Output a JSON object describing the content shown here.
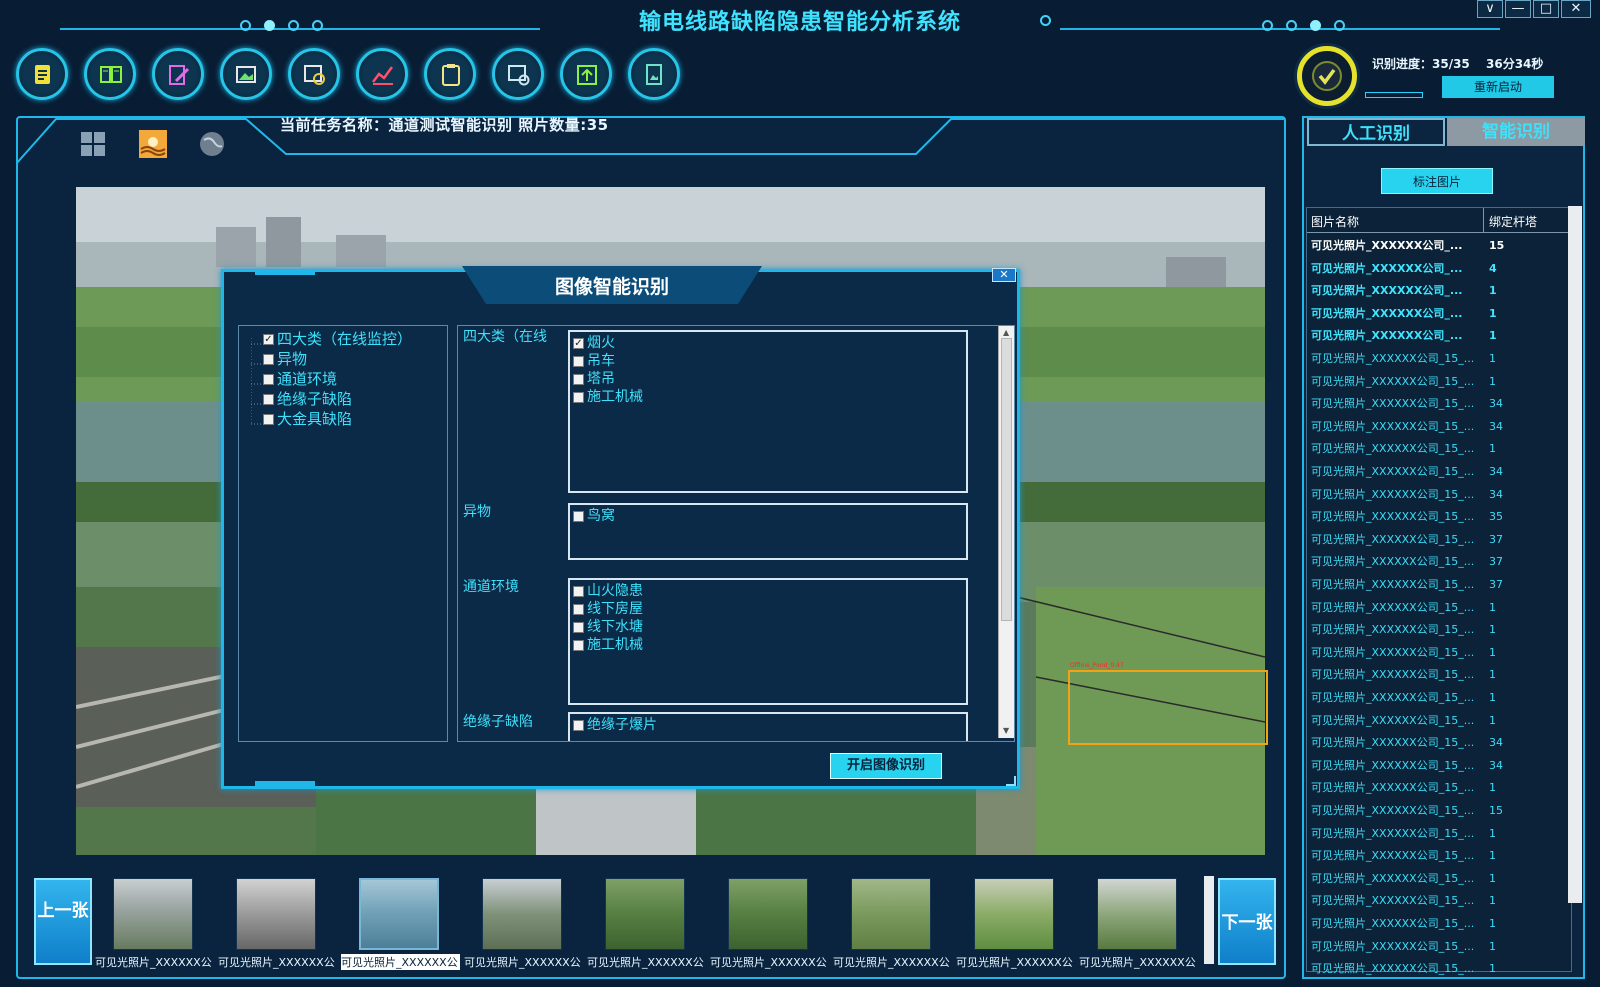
{
  "window": {
    "title": "输电线路缺陷隐患智能分析系统",
    "controls": [
      "∨",
      "—",
      "□",
      "✕"
    ]
  },
  "toolbar": {
    "icons": [
      "document-icon",
      "book-icon",
      "edit-icon",
      "image-gallery-icon",
      "image-search-icon",
      "chart-icon",
      "clipboard-icon",
      "pdf-preview-icon",
      "export-icon",
      "image-upload-icon"
    ]
  },
  "progress": {
    "label": "识别进度：35/35",
    "time": "36分34秒",
    "restart": "重新启动",
    "ratio": 1.0
  },
  "main": {
    "task": "当前任务名称：通道测试智能识别  照片数量:35",
    "view_icons": [
      "grid-icon",
      "landscape-icon",
      "globe-icon"
    ]
  },
  "photo": {
    "detection_label": "Offline_Pond_0.47"
  },
  "dialog": {
    "title": "图像智能识别",
    "close": "✕",
    "tree": [
      {
        "label": "四大类（在线监控）",
        "checked": true
      },
      {
        "label": "异物",
        "checked": false
      },
      {
        "label": "通道环境",
        "checked": false
      },
      {
        "label": "绝缘子缺陷",
        "checked": false
      },
      {
        "label": "大金具缺陷",
        "checked": false
      }
    ],
    "categories": [
      {
        "label": "四大类（在线",
        "options": [
          {
            "label": "烟火",
            "checked": true
          },
          {
            "label": "吊车",
            "checked": false
          },
          {
            "label": "塔吊",
            "checked": false
          },
          {
            "label": "施工机械",
            "checked": false
          }
        ]
      },
      {
        "label": "异物",
        "options": [
          {
            "label": "鸟窝",
            "checked": false
          }
        ]
      },
      {
        "label": "通道环境",
        "options": [
          {
            "label": "山火隐患",
            "checked": false
          },
          {
            "label": "线下房屋",
            "checked": false
          },
          {
            "label": "线下水塘",
            "checked": false
          },
          {
            "label": "施工机械",
            "checked": false
          }
        ]
      },
      {
        "label": "绝缘子缺陷",
        "options": [
          {
            "label": "绝缘子爆片",
            "checked": false
          }
        ]
      }
    ],
    "start": "开启图像识别"
  },
  "thumbnails": {
    "prev": "上一张",
    "next": "下一张",
    "captions": [
      "可见光照片_XXXXXX公",
      "可见光照片_XXXXXX公",
      "可见光照片_XXXXXX公",
      "可见光照片_XXXXXX公",
      "可见光照片_XXXXXX公",
      "可见光照片_XXXXXX公",
      "可见光照片_XXXXXX公",
      "可见光照片_XXXXXX公",
      "可见光照片_XXXXXX公"
    ],
    "selected_index": 2
  },
  "side": {
    "tabs": [
      "人工识别",
      "智能识别"
    ],
    "annotate": "标注图片",
    "columns": [
      "图片名称",
      "绑定杆塔"
    ],
    "rows": [
      {
        "name": "可见光照片_XXXXXX公司_...",
        "tower": "15",
        "style": "b1"
      },
      {
        "name": "可见光照片_XXXXXX公司_...",
        "tower": "4",
        "style": "b2"
      },
      {
        "name": "可见光照片_XXXXXX公司_...",
        "tower": "1",
        "style": "b2"
      },
      {
        "name": "可见光照片_XXXXXX公司_...",
        "tower": "1",
        "style": "b2"
      },
      {
        "name": "可见光照片_XXXXXX公司_...",
        "tower": "1",
        "style": "b2"
      },
      {
        "name": "可见光照片_XXXXXX公司_15_...",
        "tower": "1",
        "style": "n"
      },
      {
        "name": "可见光照片_XXXXXX公司_15_...",
        "tower": "1",
        "style": "n"
      },
      {
        "name": "可见光照片_XXXXXX公司_15_...",
        "tower": "34",
        "style": "n"
      },
      {
        "name": "可见光照片_XXXXXX公司_15_...",
        "tower": "34",
        "style": "n"
      },
      {
        "name": "可见光照片_XXXXXX公司_15_...",
        "tower": "1",
        "style": "n"
      },
      {
        "name": "可见光照片_XXXXXX公司_15_...",
        "tower": "34",
        "style": "n"
      },
      {
        "name": "可见光照片_XXXXXX公司_15_...",
        "tower": "34",
        "style": "n"
      },
      {
        "name": "可见光照片_XXXXXX公司_15_...",
        "tower": "35",
        "style": "n"
      },
      {
        "name": "可见光照片_XXXXXX公司_15_...",
        "tower": "37",
        "style": "n"
      },
      {
        "name": "可见光照片_XXXXXX公司_15_...",
        "tower": "37",
        "style": "n"
      },
      {
        "name": "可见光照片_XXXXXX公司_15_...",
        "tower": "37",
        "style": "n"
      },
      {
        "name": "可见光照片_XXXXXX公司_15_...",
        "tower": "1",
        "style": "n"
      },
      {
        "name": "可见光照片_XXXXXX公司_15_...",
        "tower": "1",
        "style": "n"
      },
      {
        "name": "可见光照片_XXXXXX公司_15_...",
        "tower": "1",
        "style": "n"
      },
      {
        "name": "可见光照片_XXXXXX公司_15_...",
        "tower": "1",
        "style": "n"
      },
      {
        "name": "可见光照片_XXXXXX公司_15_...",
        "tower": "1",
        "style": "n"
      },
      {
        "name": "可见光照片_XXXXXX公司_15_...",
        "tower": "1",
        "style": "n"
      },
      {
        "name": "可见光照片_XXXXXX公司_15_...",
        "tower": "34",
        "style": "n"
      },
      {
        "name": "可见光照片_XXXXXX公司_15_...",
        "tower": "34",
        "style": "n"
      },
      {
        "name": "可见光照片_XXXXXX公司_15_...",
        "tower": "1",
        "style": "n"
      },
      {
        "name": "可见光照片_XXXXXX公司_15_...",
        "tower": "15",
        "style": "n"
      },
      {
        "name": "可见光照片_XXXXXX公司_15_...",
        "tower": "1",
        "style": "n"
      },
      {
        "name": "可见光照片_XXXXXX公司_15_...",
        "tower": "1",
        "style": "n"
      },
      {
        "name": "可见光照片_XXXXXX公司_15_...",
        "tower": "1",
        "style": "n"
      },
      {
        "name": "可见光照片_XXXXXX公司_15_...",
        "tower": "1",
        "style": "n"
      },
      {
        "name": "可见光照片_XXXXXX公司_15_...",
        "tower": "1",
        "style": "n"
      },
      {
        "name": "可见光照片_XXXXXX公司_15_...",
        "tower": "1",
        "style": "n"
      },
      {
        "name": "可见光照片_XXXXXX公司_15_...",
        "tower": "1",
        "style": "n"
      }
    ]
  }
}
